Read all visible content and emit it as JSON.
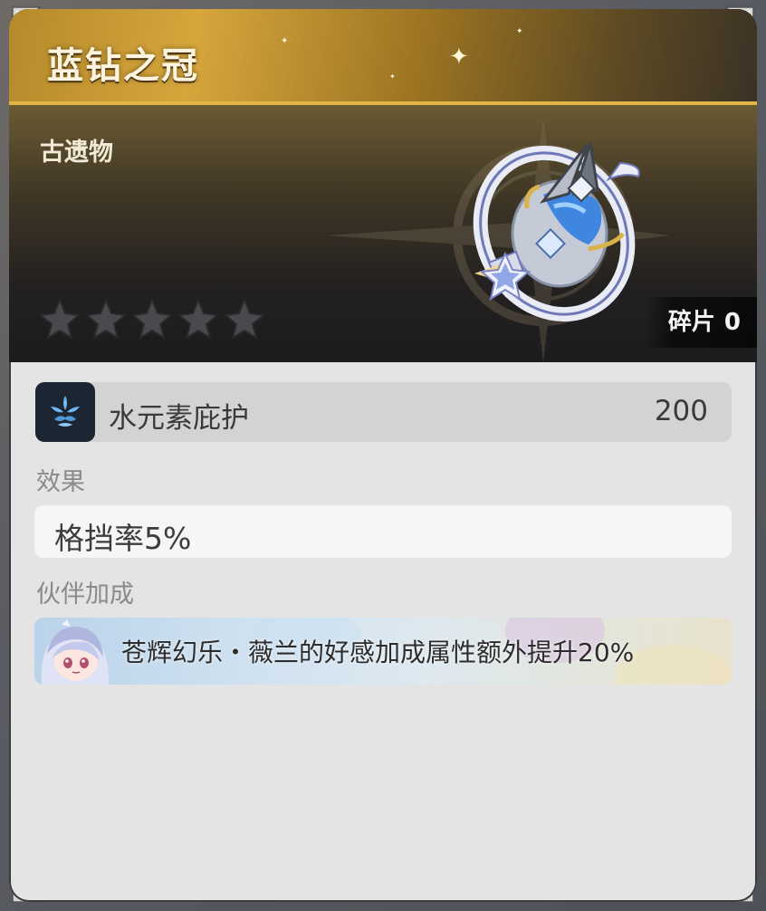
{
  "item": {
    "name": "蓝钻之冠",
    "category": "古遗物",
    "rarity_stars_filled": 0,
    "rarity_stars_total": 5,
    "fragments_label": "碎片",
    "fragments_count": "0"
  },
  "stat": {
    "icon": "hydro-element-icon",
    "name": "水元素庇护",
    "value": "200"
  },
  "effect": {
    "label": "效果",
    "text": "格挡率5%"
  },
  "partner_bonus": {
    "label": "伙伴加成",
    "text": "苍辉幻乐・薇兰的好感加成属性额外提升20%"
  },
  "colors": {
    "accent_gold": "#e2b545",
    "panel_bg": "#e4e4e4",
    "header_dark": "#1d1c1e"
  }
}
